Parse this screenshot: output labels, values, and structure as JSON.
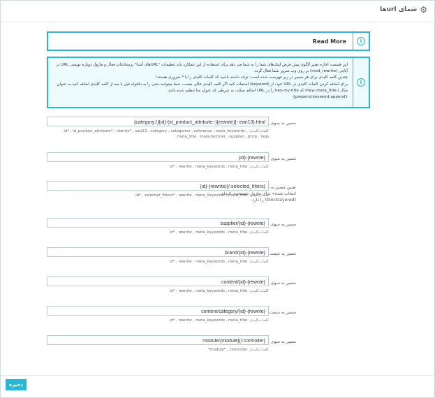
{
  "header": {
    "title": "شمای url‌ها"
  },
  "read_more": {
    "label": "Read More"
  },
  "info": {
    "lines": [
      "این قسمت اجازه تغییر الگوی پیش فرض لینک‌های شما را به شما می دهد.برای استفاده از این عملکرد باید تنظیمات \"URLهای آشنا\" پرستاشاپ فعال و ماژول دوباره نویسی URL در آپاچی (mod_rewrite) بر روی وب سرور شما فعال گردد.",
      "چندین کلمه کلیدی برای هر مسیر در زیر فهرست شده است: توجه داشته باشید که کلمات کلیدی را با * ضروری هستند!",
      "برای اضافه کردن کلمات کلیدی در URL خود، از (keyword) استفاده کنید.اگر کلمه کلیدی خالی نیست، شما میتوانید متنی را به دلخواه قبل یا بعد از کلمه کلیدی اضافه کنید.به عنوان مثال (-hey-:meta_title) که hey-my-title را در URL اضافه میکند، به شرطی که عنوان متا تنظیم شده باشد.",
      "{prepend:keyword:append}"
    ]
  },
  "keywords_label": "کلمات‌کلیدی:",
  "routes": [
    {
      "label": "مسیر به سوی محصولات",
      "value": "{category:/}{id}-{id_product_attribute:-}{rewrite}{-:ean13}.html",
      "keywords": "id* , id_product_attribute* , rewrite* , ean13 , category , categories , reference , meta_keywords , meta_title , manufacturer , supplier , price , tags"
    },
    {
      "label": "مسیر به سوی شاخه",
      "value": "{id}-{rewrite}",
      "keywords": "id* , rewrite , meta_keywords , meta_title"
    },
    {
      "label": "تعیین مسیر به دسته بندی که مشخصه «فیلتر انتخاب شده» برای ماژول جستجوی لایه‌ای (blocklayered) را دارد",
      "value": "{id}-{rewrite}{/:selected_filters}",
      "keywords": "id* , selected_filters* , rewrite , meta_keywords , meta_title"
    },
    {
      "label": "مسیر به سوی توزیع کننده",
      "value": "supplier/{id}-{rewrite}",
      "keywords": "id* , rewrite , meta_keywords , meta_title"
    },
    {
      "label": "مسیر به سمت برندها",
      "value": "brand/{id}-{rewrite}",
      "keywords": "id* , rewrite , meta_keywords , meta_title"
    },
    {
      "label": "مسیر به سوی صفحه",
      "value": "content/{id}-{rewrite}",
      "keywords": "id* , rewrite , meta_keywords , meta_title"
    },
    {
      "label": "مسیر به سمت صفحه شاخه",
      "value": "content/category/{id}-{rewrite}",
      "keywords": "id* , rewrite , meta_keywords , meta_title"
    },
    {
      "label": "مسیر به سوی ماژول‌ها",
      "value": "module/{module}{/:controller}",
      "keywords": "module* , controller*"
    }
  ],
  "save_label": "ذخیره",
  "icons": {
    "header": "gear-icon",
    "alert": "info-icon"
  },
  "colors": {
    "accent": "#25b9d7",
    "info_bg": "#eefbfd",
    "input_border": "#bbcdd2"
  }
}
